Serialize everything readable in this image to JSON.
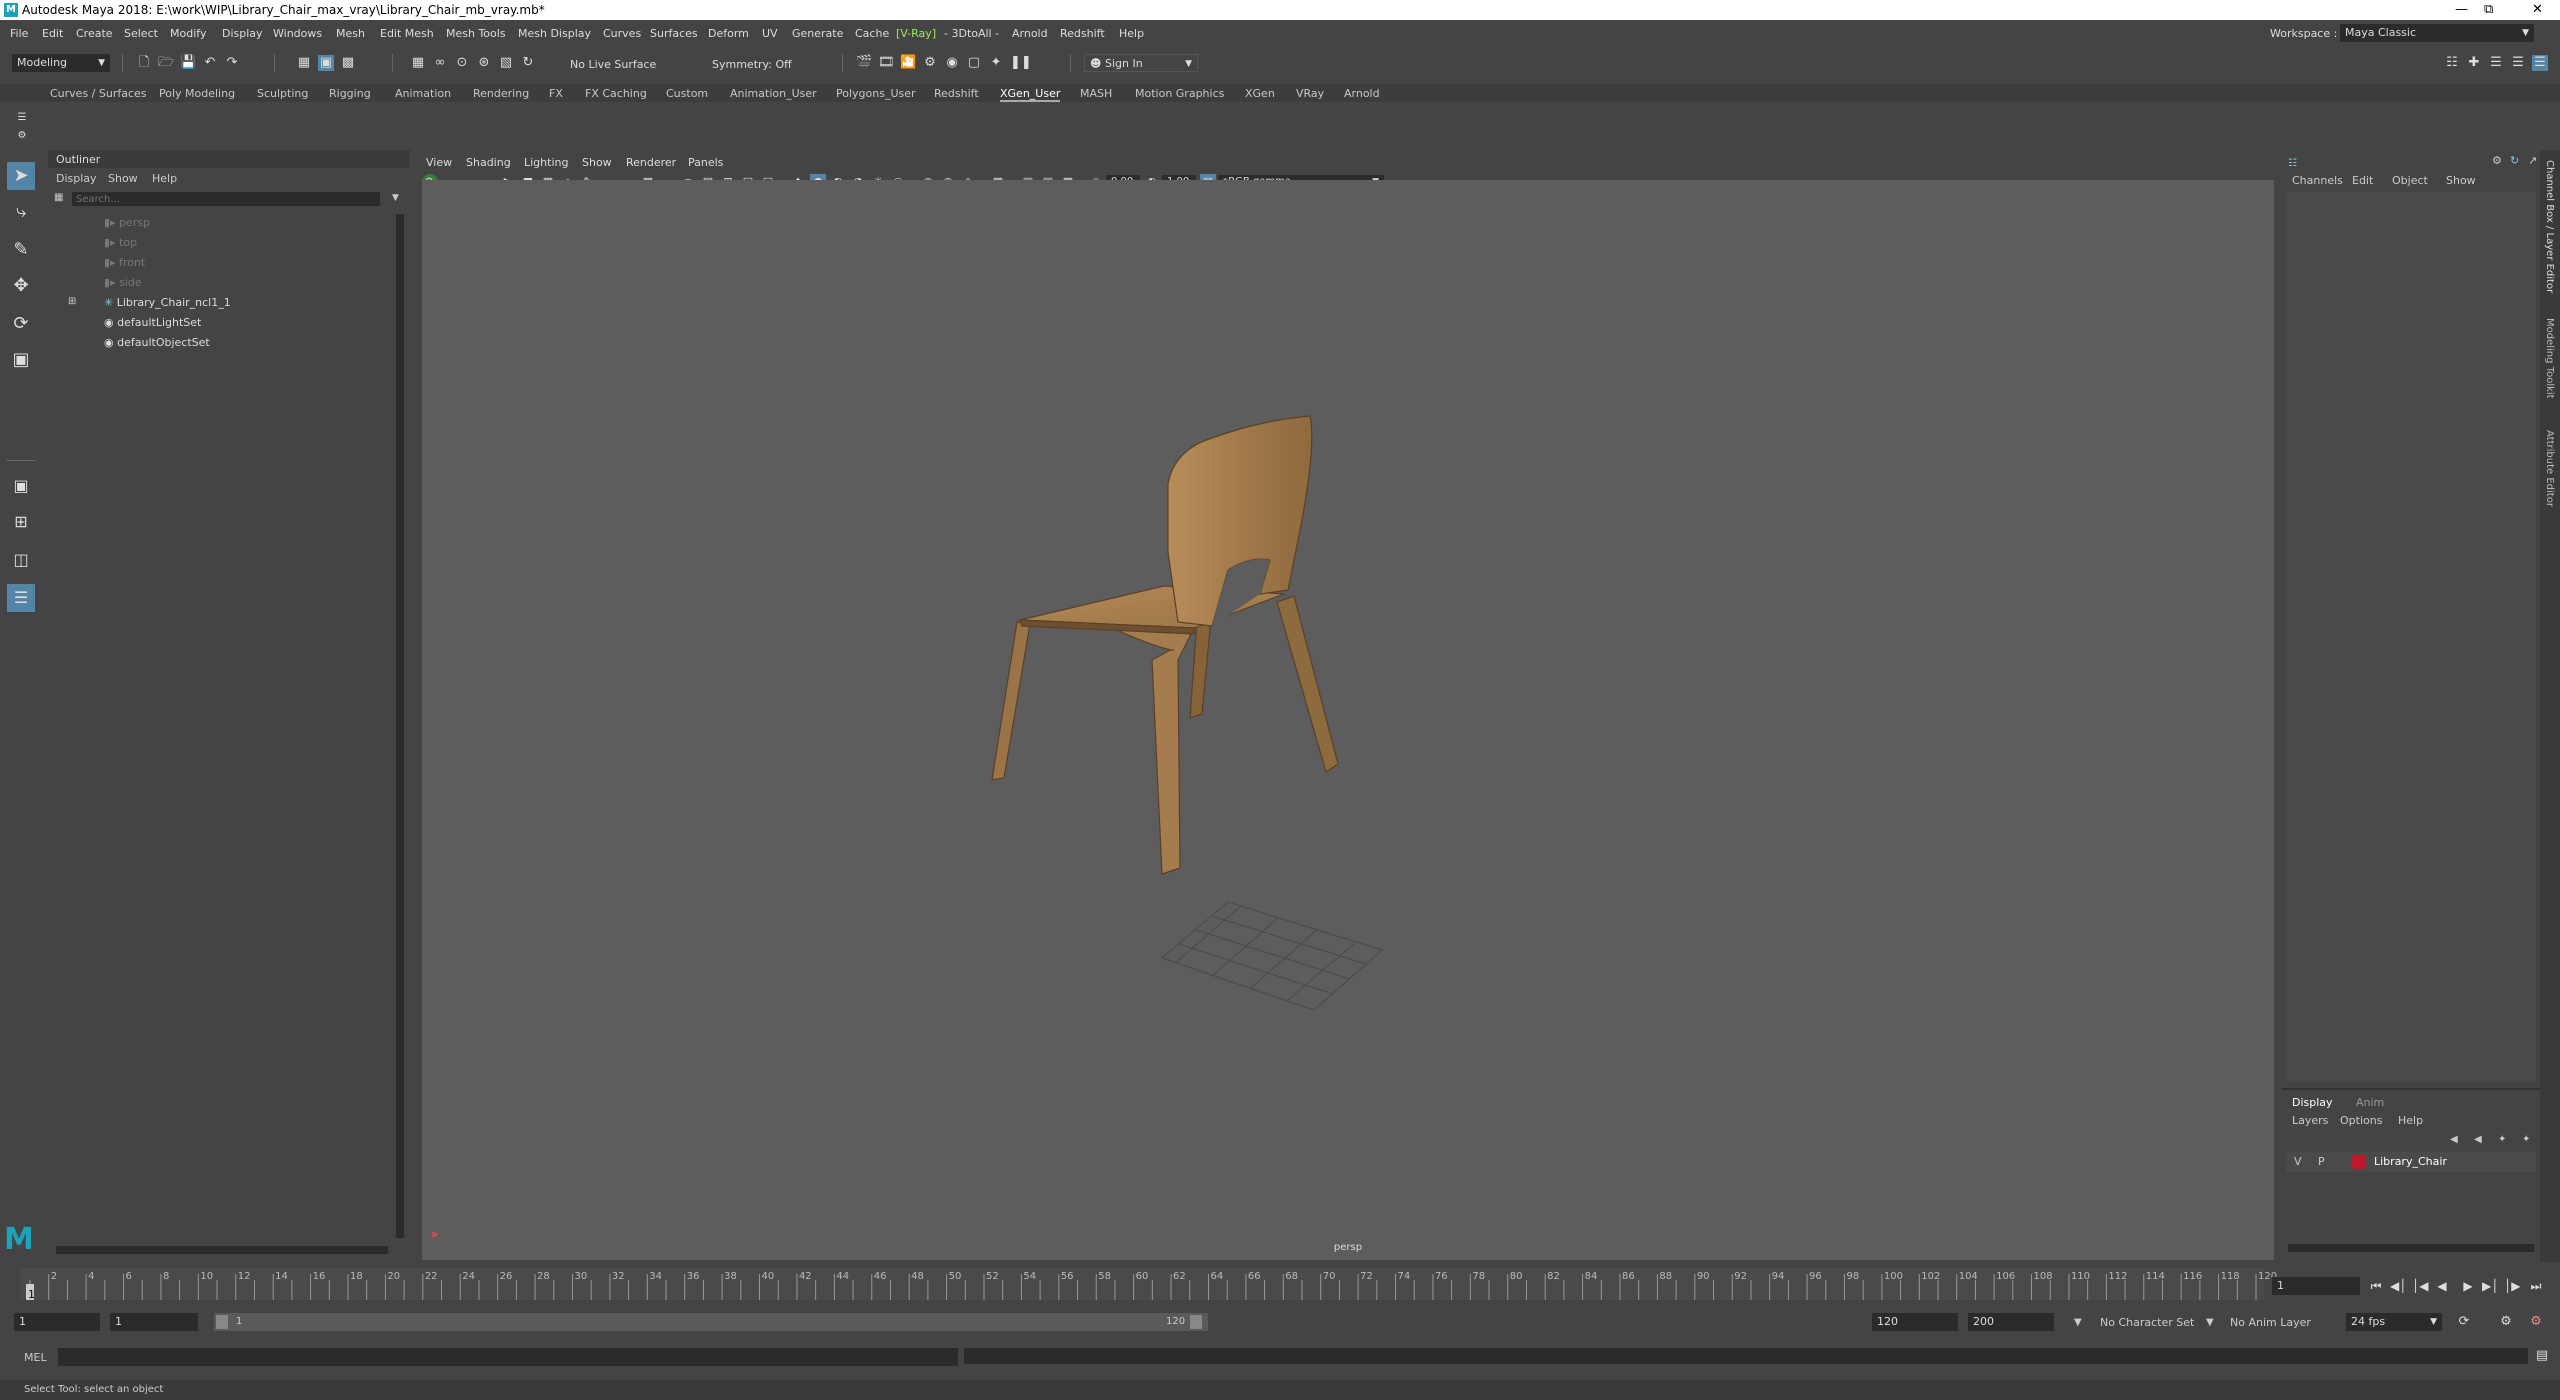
{
  "window": {
    "title": "Autodesk Maya 2018: E:\\work\\WIP\\Library_Chair_max_vray\\Library_Chair_mb_vray.mb*",
    "logo": "M"
  },
  "menubar": {
    "items": [
      "File",
      "Edit",
      "Create",
      "Select",
      "Modify",
      "Display",
      "Windows",
      "Mesh",
      "Edit Mesh",
      "Mesh Tools",
      "Mesh Display",
      "Curves",
      "Surfaces",
      "Deform",
      "UV",
      "Generate",
      "Cache",
      "V-Ray",
      "3DtoAll",
      "Arnold",
      "Redshift",
      "Help"
    ],
    "workspace_label": "Workspace :",
    "workspace_value": "Maya Classic"
  },
  "toolbar": {
    "mode": "Modeling",
    "live_surface": "No Live Surface",
    "symmetry": "Symmetry: Off",
    "sign_in": "Sign In"
  },
  "shelf_tabs": [
    "Curves / Surfaces",
    "Poly Modeling",
    "Sculpting",
    "Rigging",
    "Animation",
    "Rendering",
    "FX",
    "FX Caching",
    "Custom",
    "Animation_User",
    "Polygons_User",
    "Redshift",
    "XGen_User",
    "MASH",
    "Motion Graphics",
    "XGen",
    "VRay",
    "Arnold"
  ],
  "active_shelf_tab": "XGen_User",
  "outliner": {
    "title": "Outliner",
    "menus": [
      "Display",
      "Show",
      "Help"
    ],
    "search_placeholder": "Search...",
    "items": [
      {
        "label": "persp",
        "dim": true,
        "icon": "camera-icon"
      },
      {
        "label": "top",
        "dim": true,
        "icon": "camera-icon"
      },
      {
        "label": "front",
        "dim": true,
        "icon": "camera-icon"
      },
      {
        "label": "side",
        "dim": true,
        "icon": "camera-icon"
      },
      {
        "label": "Library_Chair_ncl1_1",
        "dim": false,
        "icon": "group-icon",
        "expandable": true
      },
      {
        "label": "defaultLightSet",
        "dim": false,
        "icon": "set-icon"
      },
      {
        "label": "defaultObjectSet",
        "dim": false,
        "icon": "set-icon"
      }
    ]
  },
  "viewport": {
    "menus": [
      "View",
      "Shading",
      "Lighting",
      "Show",
      "Renderer",
      "Panels"
    ],
    "exposure": "0.00",
    "gamma": "1.00",
    "color_space": "sRGB gamma",
    "camera_label": "persp"
  },
  "channel_box": {
    "menus": [
      "Channels",
      "Edit",
      "Object",
      "Show"
    ],
    "layer_tabs": [
      "Display",
      "Anim"
    ],
    "layer_menus": [
      "Layers",
      "Options",
      "Help"
    ],
    "layer": {
      "v": "V",
      "p": "P",
      "name": "Library_Chair",
      "color": "#c0182a"
    }
  },
  "side_tabs": [
    "Channel Box / Layer Editor",
    "Modeling Toolkit",
    "Attribute Editor"
  ],
  "timeline": {
    "ticks": [
      "2",
      "4",
      "6",
      "8",
      "10",
      "12",
      "14",
      "16",
      "18",
      "20",
      "22",
      "24",
      "26",
      "28",
      "30",
      "32",
      "34",
      "36",
      "38",
      "40",
      "42",
      "44",
      "46",
      "48",
      "50",
      "52",
      "54",
      "56",
      "58",
      "60",
      "62",
      "64",
      "66",
      "68",
      "70",
      "72",
      "74",
      "76",
      "78",
      "80",
      "82",
      "84",
      "86",
      "88",
      "90",
      "92",
      "94",
      "96",
      "98",
      "100",
      "102",
      "104",
      "106",
      "108",
      "110",
      "112",
      "114",
      "116",
      "118",
      "120"
    ],
    "current_frame": "1",
    "start_marker": "1"
  },
  "range": {
    "start": "1",
    "playback_start": "1",
    "slider_start": "1",
    "slider_end": "120",
    "playback_end": "120",
    "end": "200",
    "character_set": "No Character Set",
    "anim_layer": "No Anim Layer",
    "fps": "24 fps"
  },
  "command": {
    "label": "MEL"
  },
  "help_line": "Select Tool: select an object",
  "colors": {
    "chair": "#a47c4e",
    "viewport_bg": "#5d5d5d",
    "panel": "#444444",
    "active_blue": "#5285a6"
  }
}
